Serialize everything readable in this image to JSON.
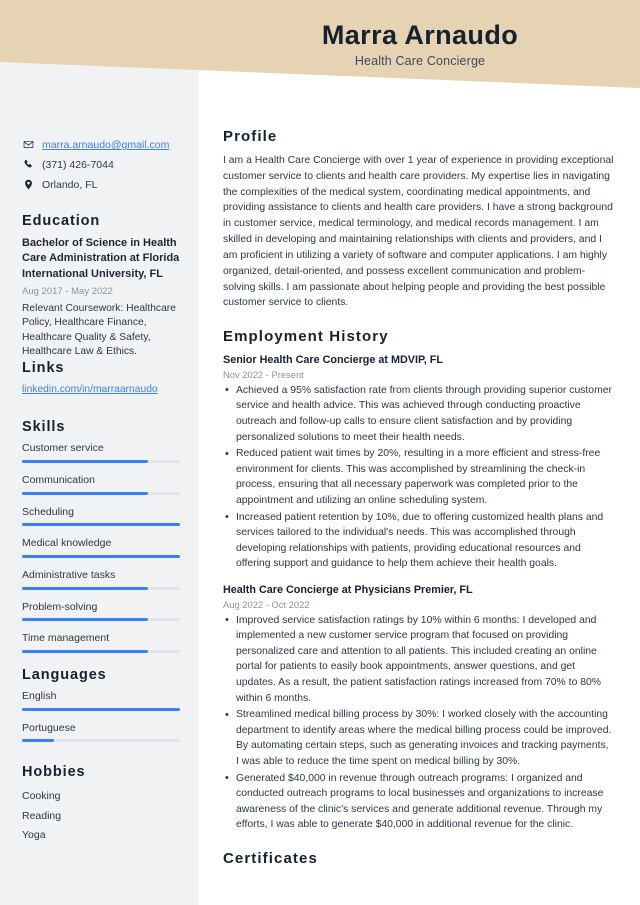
{
  "header": {
    "full_name": "Marra Arnaudo",
    "job_title": "Health Care Concierge",
    "banner_color": "#e5d3b3"
  },
  "theme": {
    "accent": "#3b7ff5",
    "sidebar_bg": "#f1f2f4",
    "heading": "#17202c",
    "body_text": "#2e3744",
    "muted": "#8b93a0"
  },
  "sidebar": {
    "contact": [
      {
        "icon": "envelope-icon",
        "text": "marra.arnaudo@gmail.com",
        "is_link": true
      },
      {
        "icon": "phone-icon",
        "text": "(371) 426-7044",
        "is_link": false
      },
      {
        "icon": "location-pin-icon",
        "text": "Orlando, FL",
        "is_link": false
      }
    ],
    "education": {
      "heading": "Education",
      "degree": "Bachelor of Science in Health Care Administration at Florida International University, FL",
      "date": "Aug 2017 - May 2022",
      "description": "Relevant Coursework: Healthcare Policy, Healthcare Finance, Healthcare Quality & Safety, Healthcare Law & Ethics."
    },
    "links": {
      "heading": "Links",
      "items": [
        {
          "label": "linkedin.com/in/marraarnaudo"
        }
      ]
    },
    "skills": {
      "heading": "Skills",
      "items": [
        {
          "label": "Customer service",
          "level": 80
        },
        {
          "label": "Communication",
          "level": 80
        },
        {
          "label": "Scheduling",
          "level": 100
        },
        {
          "label": "Medical knowledge",
          "level": 100
        },
        {
          "label": "Administrative tasks",
          "level": 80
        },
        {
          "label": "Problem-solving",
          "level": 80
        },
        {
          "label": "Time management",
          "level": 80
        }
      ]
    },
    "languages": {
      "heading": "Languages",
      "items": [
        {
          "label": "English",
          "level": 100
        },
        {
          "label": "Portuguese",
          "level": 20
        }
      ]
    },
    "hobbies": {
      "heading": "Hobbies",
      "items": [
        {
          "label": "Cooking"
        },
        {
          "label": "Reading"
        },
        {
          "label": "Yoga"
        }
      ]
    }
  },
  "main": {
    "profile": {
      "heading": "Profile",
      "text": "I am a Health Care Concierge with over 1 year of experience in providing exceptional customer service to clients and health care providers. My expertise lies in navigating the complexities of the medical system, coordinating medical appointments, and providing assistance to clients and health care providers. I have a strong background in customer service, medical terminology, and medical records management. I am skilled in developing and maintaining relationships with clients and providers, and I am proficient in utilizing a variety of software and computer applications. I am highly organized, detail-oriented, and possess excellent communication and problem-solving skills. I am passionate about helping people and providing the best possible customer service to clients."
    },
    "employment": {
      "heading": "Employment History",
      "jobs": [
        {
          "role": "Senior Health Care Concierge at MDVIP, FL",
          "date": "Nov 2022 - Present",
          "bullets": [
            "Achieved a 95% satisfaction rate from clients through providing superior customer service and health advice. This was achieved through conducting proactive outreach and follow-up calls to ensure client satisfaction and by providing personalized solutions to meet their health needs.",
            "Reduced patient wait times by 20%, resulting in a more efficient and stress-free environment for clients. This was accomplished by streamlining the check-in process, ensuring that all necessary paperwork was completed prior to the appointment and utilizing an online scheduling system.",
            "Increased patient retention by 10%, due to offering customized health plans and services tailored to the individual's needs. This was accomplished through developing relationships with patients, providing educational resources and offering support and guidance to help them achieve their health goals."
          ]
        },
        {
          "role": "Health Care Concierge at Physicians Premier, FL",
          "date": "Aug 2022 - Oct 2022",
          "bullets": [
            "Improved service satisfaction ratings by 10% within 6 months: I developed and implemented a new customer service program that focused on providing personalized care and attention to all patients. This included creating an online portal for patients to easily book appointments, answer questions, and get updates. As a result, the patient satisfaction ratings increased from 70% to 80% within 6 months.",
            "Streamlined medical billing process by 30%: I worked closely with the accounting department to identify areas where the medical billing process could be improved. By automating certain steps, such as generating invoices and tracking payments, I was able to reduce the time spent on medical billing by 30%.",
            "Generated $40,000 in revenue through outreach programs: I organized and conducted outreach programs to local businesses and organizations to increase awareness of the clinic's services and generate additional revenue. Through my efforts, I was able to generate $40,000 in additional revenue for the clinic."
          ]
        }
      ]
    },
    "certificates": {
      "heading": "Certificates"
    }
  }
}
